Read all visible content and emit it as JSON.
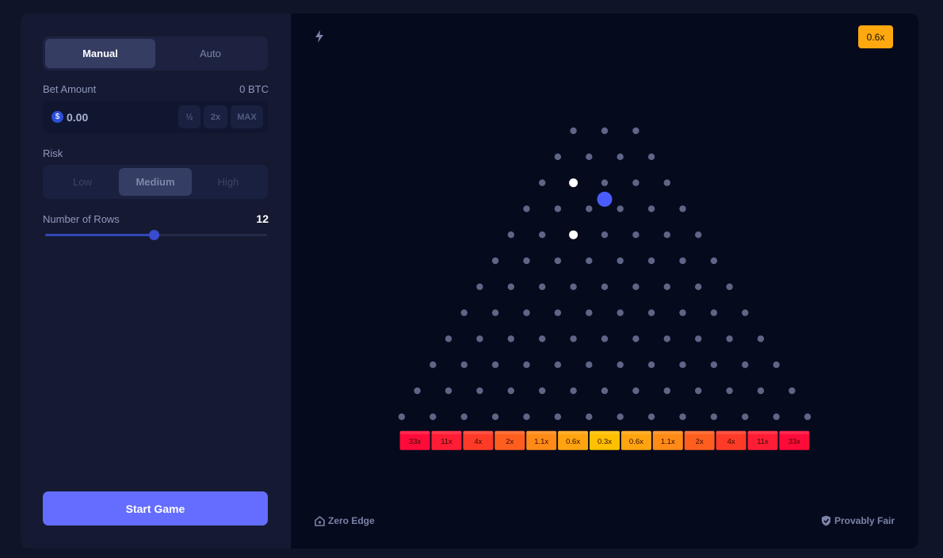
{
  "sidebar": {
    "tabs": [
      {
        "label": "Manual",
        "active": true
      },
      {
        "label": "Auto",
        "active": false
      }
    ],
    "bet": {
      "label": "Bet Amount",
      "balance": "0 BTC",
      "value": "0.00",
      "currency_symbol": "$",
      "half_label": "½",
      "double_label": "2x",
      "max_label": "MAX"
    },
    "risk": {
      "label": "Risk",
      "options": [
        {
          "label": "Low",
          "active": false
        },
        {
          "label": "Medium",
          "active": true
        },
        {
          "label": "High",
          "active": false
        }
      ]
    },
    "rows": {
      "label": "Number of Rows",
      "value": "12",
      "slider_fraction": 0.49
    },
    "start_label": "Start Game"
  },
  "game": {
    "last_multiplier": "0.6x",
    "rows": 12,
    "highlighted_pegs": [
      [
        2,
        1
      ],
      [
        4,
        2
      ]
    ],
    "ball": {
      "after_row": 3,
      "between_pegs": [
        2,
        3
      ]
    },
    "multipliers": [
      "33x",
      "11x",
      "4x",
      "2x",
      "1.1x",
      "0.6x",
      "0.3x",
      "0.6x",
      "1.1x",
      "2x",
      "4x",
      "11x",
      "33x"
    ],
    "bucket_colors": [
      "#ff0b3a",
      "#ff1c35",
      "#ff3b28",
      "#ff5e1f",
      "#ff8a16",
      "#ffa40e",
      "#ffc000",
      "#ffa40e",
      "#ff8a16",
      "#ff5e1f",
      "#ff3b28",
      "#ff1c35",
      "#ff0b3a"
    ],
    "footer": {
      "zero_edge": "Zero Edge",
      "provably_fair": "Provably Fair"
    }
  },
  "colors": {
    "accent": "#646dff",
    "peg": "#5e6585",
    "ball": "#4b5cff"
  }
}
